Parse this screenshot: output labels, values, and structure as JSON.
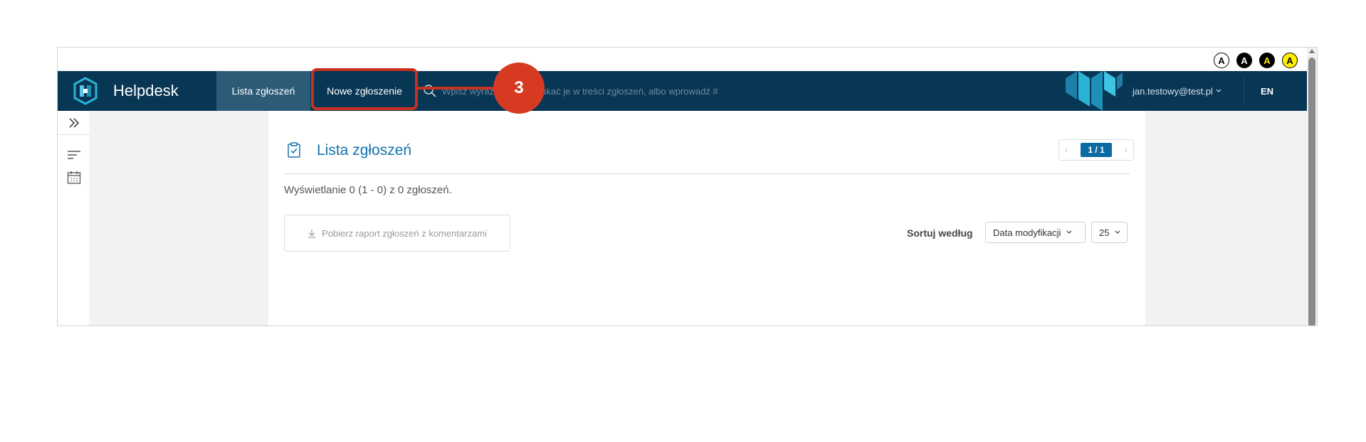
{
  "contrast_buttons": [
    {
      "label": "A",
      "bg": "#ffffff",
      "fg": "#000000"
    },
    {
      "label": "A",
      "bg": "#000000",
      "fg": "#ffffff"
    },
    {
      "label": "A",
      "bg": "#000000",
      "fg": "#ffee00"
    },
    {
      "label": "A",
      "bg": "#ffee00",
      "fg": "#000000"
    }
  ],
  "header": {
    "app_title": "Helpdesk",
    "tabs": [
      {
        "label": "Lista zgłoszeń",
        "active": true
      },
      {
        "label": "Nowe zgłoszenie",
        "active": false
      }
    ],
    "search_placeholder": "Wpisz wyrazy, aby wyszukać je w treści zgłoszeń, albo wprowadź #",
    "user": "jan.testowy@test.pl",
    "language": "EN"
  },
  "sidebar": {
    "toggle_icon": "double-chevron-right-icon",
    "icons": [
      "filter-lines-icon",
      "calendar-icon"
    ]
  },
  "main": {
    "title": "Lista zgłoszeń",
    "title_icon": "clipboard-check-icon",
    "pagination": {
      "current": "1 / 1"
    },
    "count_text": "Wyświetlanie 0 (1 - 0) z 0 zgłoszeń.",
    "report_button": "Pobierz raport zgłoszeń z komentarzami",
    "sort_label": "Sortuj według",
    "sort_value": "Data modyfikacji",
    "per_page": "25"
  },
  "annotation": {
    "step_number": "3"
  },
  "colors": {
    "nav_bg": "#083655",
    "nav_active": "#2c5b78",
    "accent": "#1572a8",
    "annotation": "#d63a21"
  }
}
